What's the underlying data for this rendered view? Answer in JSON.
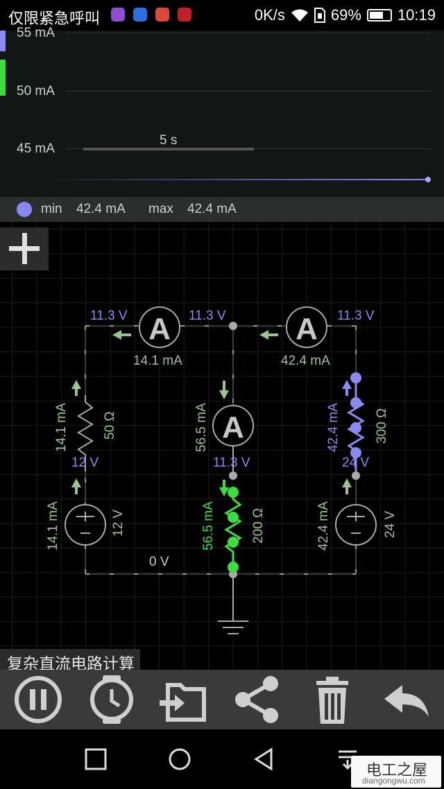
{
  "status_bar": {
    "carrier_text": "仅限紧急呼叫",
    "net_speed": "0K/s",
    "battery": "69%",
    "battery_level": 0.69,
    "time": "10:19"
  },
  "graph": {
    "y_labels": [
      "55 mA",
      "50 mA",
      "45 mA"
    ],
    "time_span": "5 s",
    "trace_color": "#8a8af0"
  },
  "legend": {
    "min_label": "min",
    "min_value": "42.4 mA",
    "max_label": "max",
    "max_value": "42.4 mA"
  },
  "circuit": {
    "node_voltages": {
      "top_left": "11.3 V",
      "top_mid": "11.3 V",
      "top_right": "11.3 V",
      "mid_left": "12 V",
      "mid_center": "11.3 V",
      "mid_right": "24 V",
      "ground": "0 V"
    },
    "ammeters": {
      "left_current": "14.1 mA",
      "right_current": "42.4 mA"
    },
    "left_branch": {
      "resistor_current": "14.1 mA",
      "resistor_value": "50 Ω",
      "source_current": "14.1 mA",
      "source_value": "12 V"
    },
    "center_branch": {
      "ammeter_current": "56.5 mA",
      "resistor_current": "56.5 mA",
      "resistor_value": "200 Ω"
    },
    "right_branch": {
      "resistor_current": "42.4 mA",
      "resistor_value": "300 Ω",
      "source_current": "42.4 mA",
      "source_value": "24 V"
    },
    "wire_color": "#7fa878",
    "highlight_green": "#3fdc3f",
    "highlight_blue": "#8a8af0"
  },
  "caption": "复杂直流电路计算",
  "toolbar": {
    "icons": [
      "pause-icon",
      "clock-icon",
      "import-icon",
      "share-icon",
      "trash-icon",
      "undo-icon"
    ]
  },
  "watermark": {
    "title": "电工之屋",
    "url": "diangongwu.com"
  }
}
